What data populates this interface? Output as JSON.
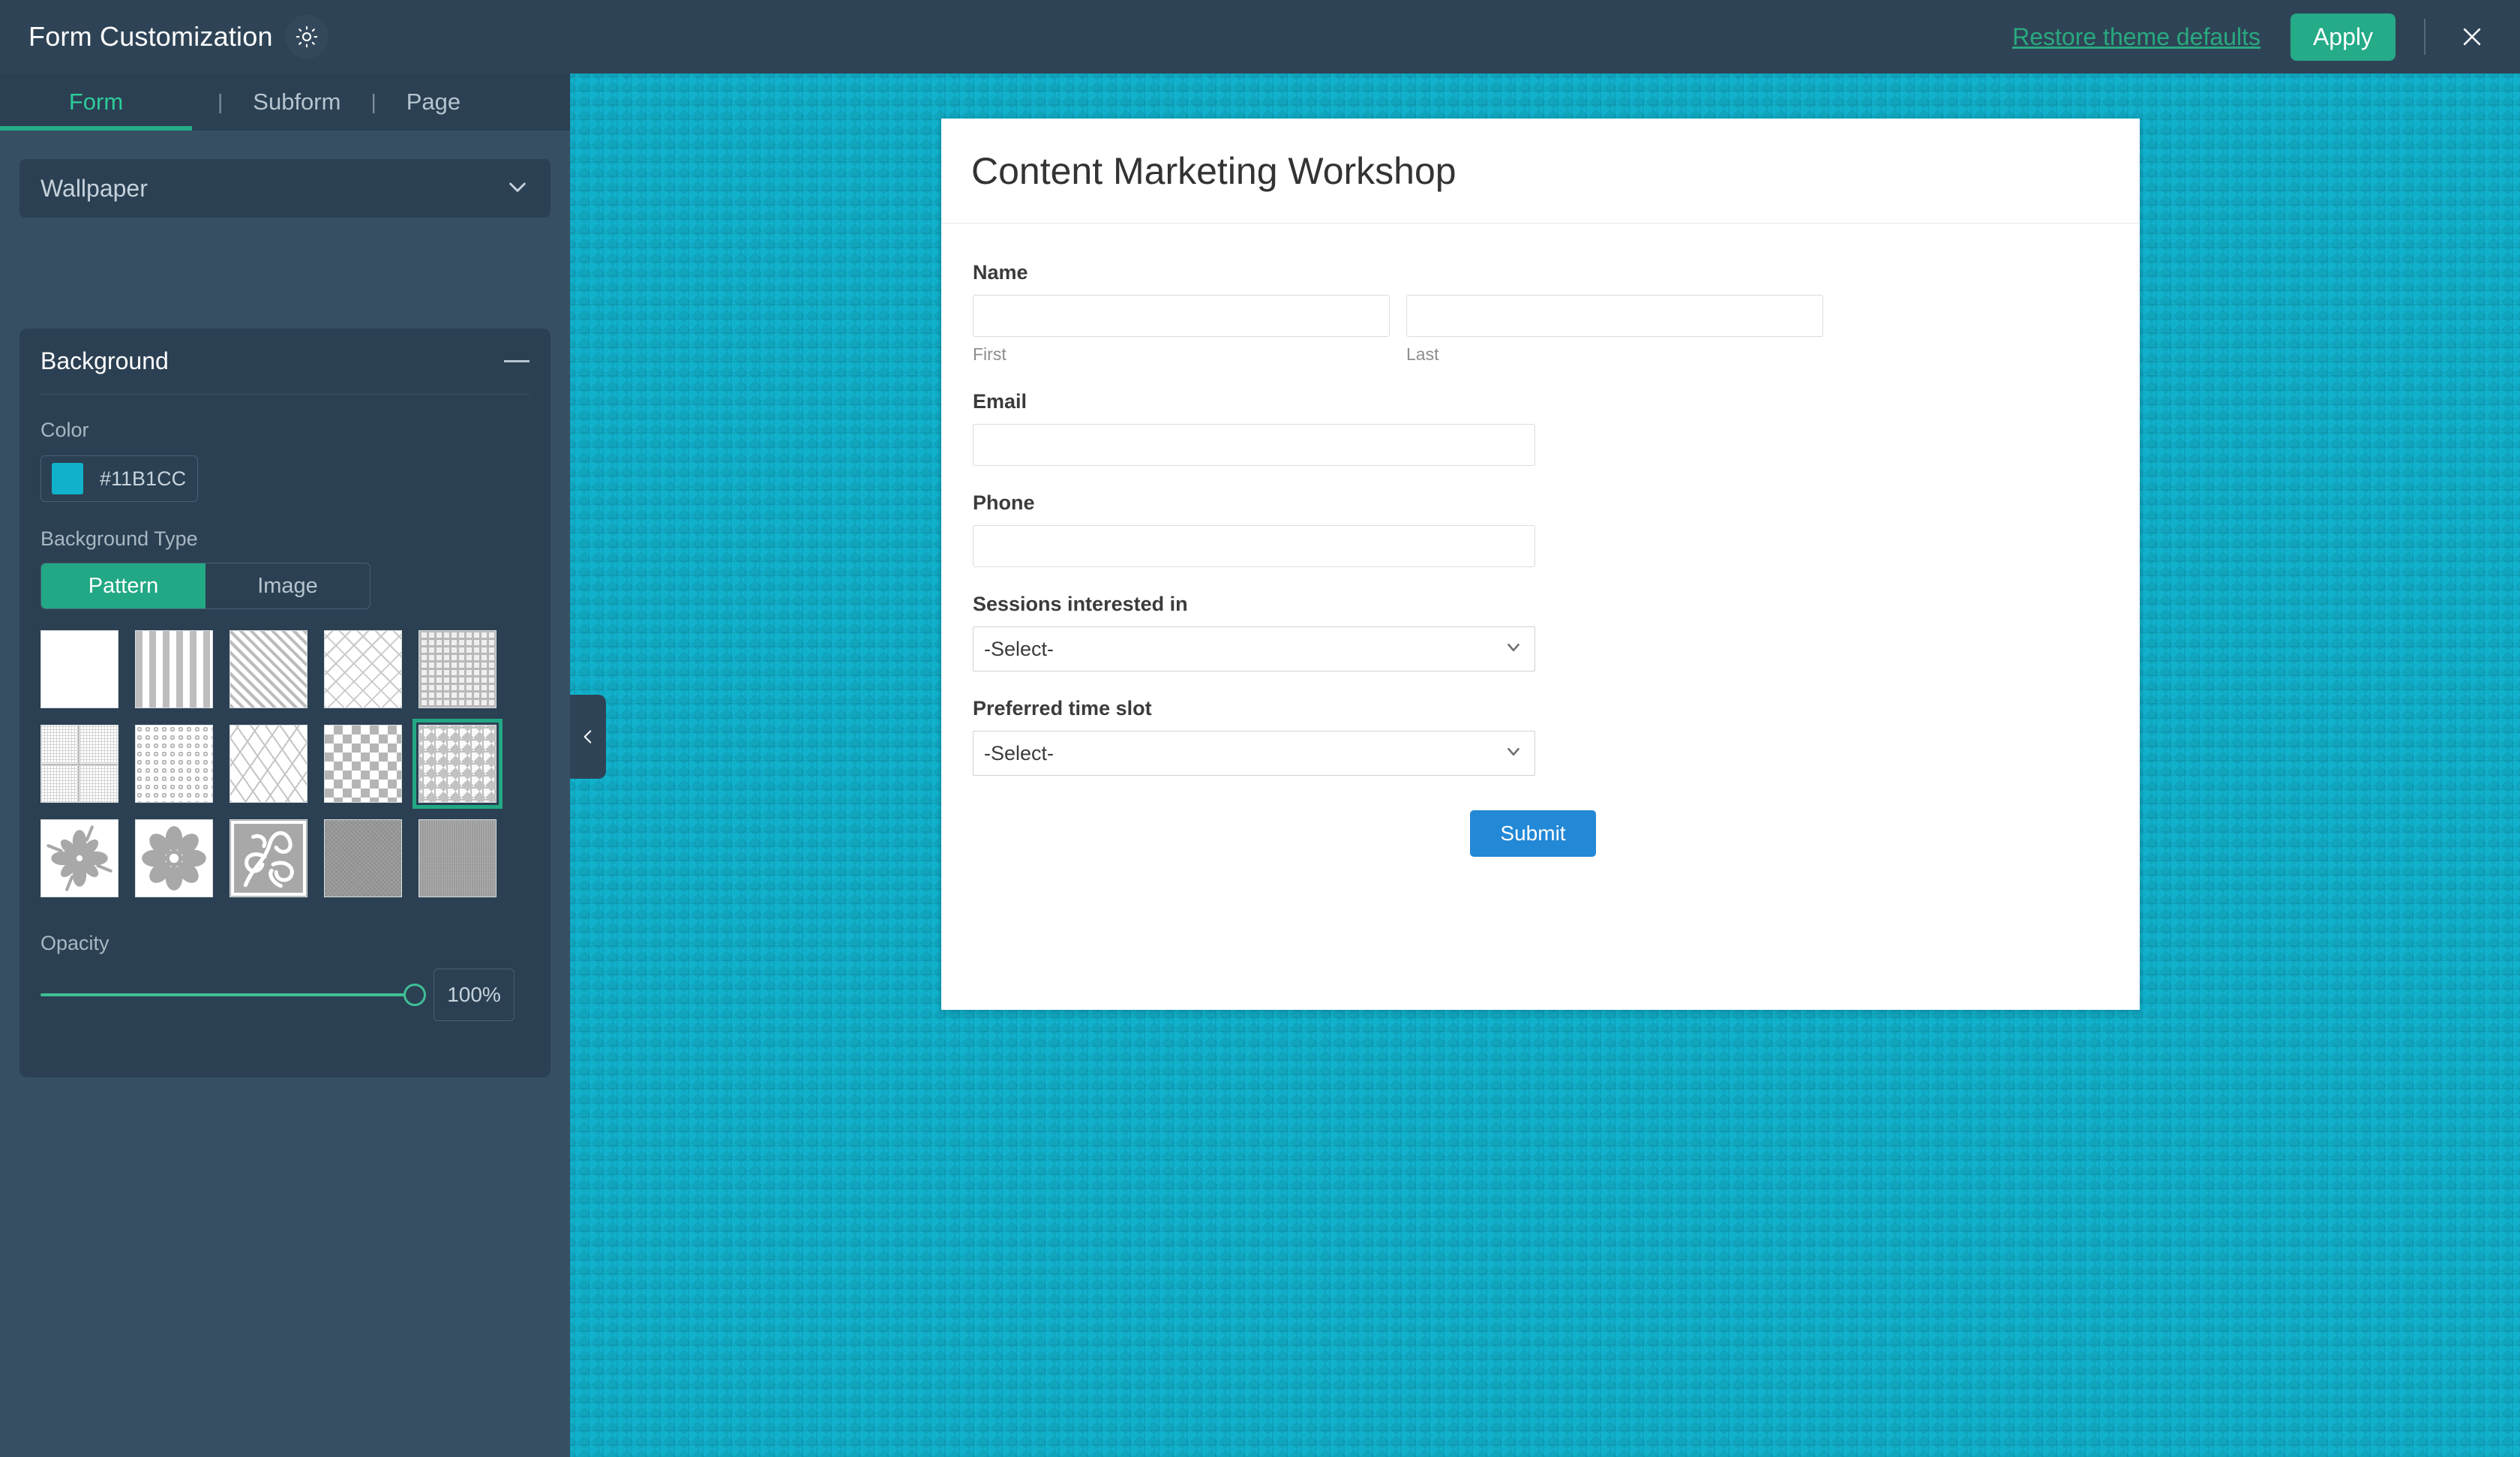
{
  "topbar": {
    "app_title": "Form Customization",
    "theme_toggle_icon": "sun-icon",
    "restore_label": "Restore theme defaults",
    "apply_label": "Apply",
    "close_icon": "close-icon"
  },
  "sidebar": {
    "tabs": [
      {
        "label": "Form",
        "active": true
      },
      {
        "label": "Subform",
        "active": false
      },
      {
        "label": "Page",
        "active": false
      }
    ],
    "tab_separator": "|",
    "wallpaper_select": {
      "value": "Wallpaper",
      "caret_icon": "chevron-down-icon"
    },
    "background_panel": {
      "title": "Background",
      "collapse_icon": "minus-icon",
      "color": {
        "label": "Color",
        "hex": "#11B1CC",
        "chip_color": "#11B1CC"
      },
      "background_type": {
        "label": "Background Type",
        "options": [
          "Pattern",
          "Image"
        ],
        "selected": "Pattern"
      },
      "patterns": {
        "selected_index": 9,
        "items": [
          {
            "name": "solid-white"
          },
          {
            "name": "vertical-stripes"
          },
          {
            "name": "diagonal-stripes"
          },
          {
            "name": "diamond-lattice"
          },
          {
            "name": "small-squares-grid"
          },
          {
            "name": "graph-paper"
          },
          {
            "name": "polka-rings"
          },
          {
            "name": "diagonal-weave"
          },
          {
            "name": "checkerboard"
          },
          {
            "name": "squares-diamonds"
          },
          {
            "name": "floral-burst"
          },
          {
            "name": "flower-petals"
          },
          {
            "name": "ornate-damask"
          },
          {
            "name": "gray-texture"
          },
          {
            "name": "gray-linen"
          }
        ]
      },
      "opacity": {
        "label": "Opacity",
        "value": "100%",
        "percent": 100
      }
    }
  },
  "preview": {
    "collapse_handle_icon": "chevron-left-icon",
    "background_color": "#11B1CC",
    "form": {
      "title": "Content Marketing Workshop",
      "fields": [
        {
          "type": "name",
          "label": "Name",
          "sub_labels": [
            "First",
            "Last"
          ],
          "values": [
            "",
            ""
          ]
        },
        {
          "type": "text",
          "label": "Email",
          "value": ""
        },
        {
          "type": "text",
          "label": "Phone",
          "value": ""
        },
        {
          "type": "select",
          "label": "Sessions interested in",
          "value": "-Select-"
        },
        {
          "type": "select",
          "label": "Preferred time slot",
          "value": "-Select-"
        }
      ],
      "submit_label": "Submit",
      "submit_color": "#2388D6"
    }
  }
}
